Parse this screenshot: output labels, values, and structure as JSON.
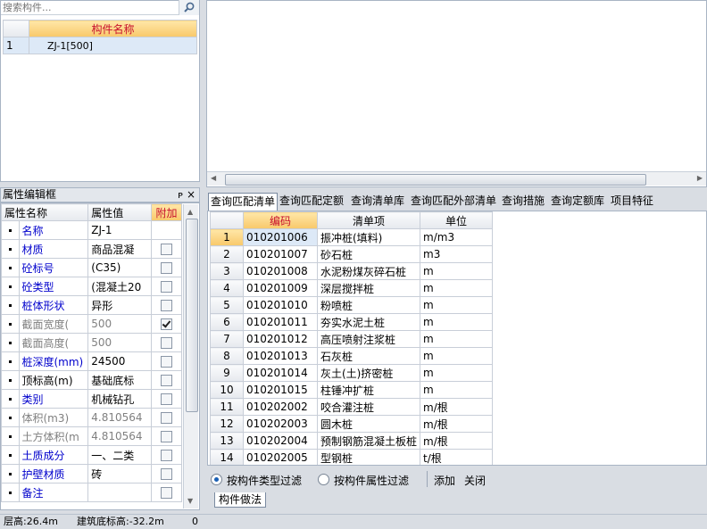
{
  "search": {
    "placeholder": "搜索构件..."
  },
  "component_list": {
    "header": "构件名称",
    "rows": [
      {
        "num": "1",
        "name": "ZJ-1[500]"
      }
    ]
  },
  "attr_panel": {
    "title": "属性编辑框",
    "pin": "ᴘ",
    "close": "×",
    "headers": {
      "name": "属性名称",
      "value": "属性值",
      "extra": "附加"
    },
    "rows": [
      {
        "name": "名称",
        "value": "ZJ-1",
        "style": "blue",
        "chk": "none"
      },
      {
        "name": "材质",
        "value": "商品混凝",
        "style": "blue",
        "chk": "off"
      },
      {
        "name": "砼标号",
        "value": "(C35)",
        "style": "blue",
        "chk": "off"
      },
      {
        "name": "砼类型",
        "value": "(混凝土20",
        "style": "blue",
        "chk": "off"
      },
      {
        "name": "桩体形状",
        "value": "异形",
        "style": "blue",
        "chk": "off"
      },
      {
        "name": "截面宽度(",
        "value": "500",
        "style": "gray",
        "chk": "on"
      },
      {
        "name": "截面高度(",
        "value": "500",
        "style": "gray",
        "chk": "off"
      },
      {
        "name": "桩深度(mm)",
        "value": "24500",
        "style": "blue",
        "chk": "off"
      },
      {
        "name": "顶标高(m)",
        "value": "基础底标",
        "style": "black",
        "chk": "off"
      },
      {
        "name": "类别",
        "value": "机械钻孔",
        "style": "blue",
        "chk": "off"
      },
      {
        "name": "体积(m3)",
        "value": "4.810564",
        "style": "gray",
        "chk": "off"
      },
      {
        "name": "土方体积(m",
        "value": "4.810564",
        "style": "gray",
        "chk": "off"
      },
      {
        "name": "土质成分",
        "value": "一、二类",
        "style": "blue",
        "chk": "off"
      },
      {
        "name": "护壁材质",
        "value": "砖",
        "style": "blue",
        "chk": "off"
      },
      {
        "name": "备注",
        "value": "",
        "style": "blue",
        "chk": "off"
      }
    ]
  },
  "tabs": [
    {
      "label": "查询匹配清单",
      "active": true
    },
    {
      "label": "查询匹配定额"
    },
    {
      "label": "查询清单库"
    },
    {
      "label": "查询匹配外部清单"
    },
    {
      "label": "查询措施"
    },
    {
      "label": "查询定额库"
    },
    {
      "label": "项目特征"
    }
  ],
  "query_table": {
    "headers": {
      "code": "编码",
      "item": "清单项",
      "unit": "单位"
    },
    "rows": [
      {
        "num": "1",
        "code": "010201006",
        "item": "振冲桩(填料)",
        "unit": "m/m3"
      },
      {
        "num": "2",
        "code": "010201007",
        "item": "砂石桩",
        "unit": "m3"
      },
      {
        "num": "3",
        "code": "010201008",
        "item": "水泥粉煤灰碎石桩",
        "unit": "m"
      },
      {
        "num": "4",
        "code": "010201009",
        "item": "深层搅拌桩",
        "unit": "m"
      },
      {
        "num": "5",
        "code": "010201010",
        "item": "粉喷桩",
        "unit": "m"
      },
      {
        "num": "6",
        "code": "010201011",
        "item": "夯实水泥土桩",
        "unit": "m"
      },
      {
        "num": "7",
        "code": "010201012",
        "item": "高压喷射注浆桩",
        "unit": "m"
      },
      {
        "num": "8",
        "code": "010201013",
        "item": "石灰桩",
        "unit": "m"
      },
      {
        "num": "9",
        "code": "010201014",
        "item": "灰土(土)挤密桩",
        "unit": "m"
      },
      {
        "num": "10",
        "code": "010201015",
        "item": "柱锤冲扩桩",
        "unit": "m"
      },
      {
        "num": "11",
        "code": "010202002",
        "item": "咬合灌注桩",
        "unit": "m/根"
      },
      {
        "num": "12",
        "code": "010202003",
        "item": "圆木桩",
        "unit": "m/根"
      },
      {
        "num": "13",
        "code": "010202004",
        "item": "预制钢筋混凝土板桩",
        "unit": "m/根"
      },
      {
        "num": "14",
        "code": "010202005",
        "item": "型钢桩",
        "unit": "t/根"
      }
    ]
  },
  "filter": {
    "by_type": "按构件类型过滤",
    "by_attr": "按构件属性过滤",
    "add": "添加",
    "close": "关闭"
  },
  "bottom_tab": {
    "label": "构件做法"
  },
  "status": {
    "floor_height": "层高:26.4m",
    "base_elevation": "建筑底标高:-32.2m",
    "extra": "0"
  },
  "colors": {
    "header_orange": "#f8c86a",
    "header_text": "#c8102e",
    "label_blue": "#0000cc",
    "selection": "#dde9f7"
  }
}
